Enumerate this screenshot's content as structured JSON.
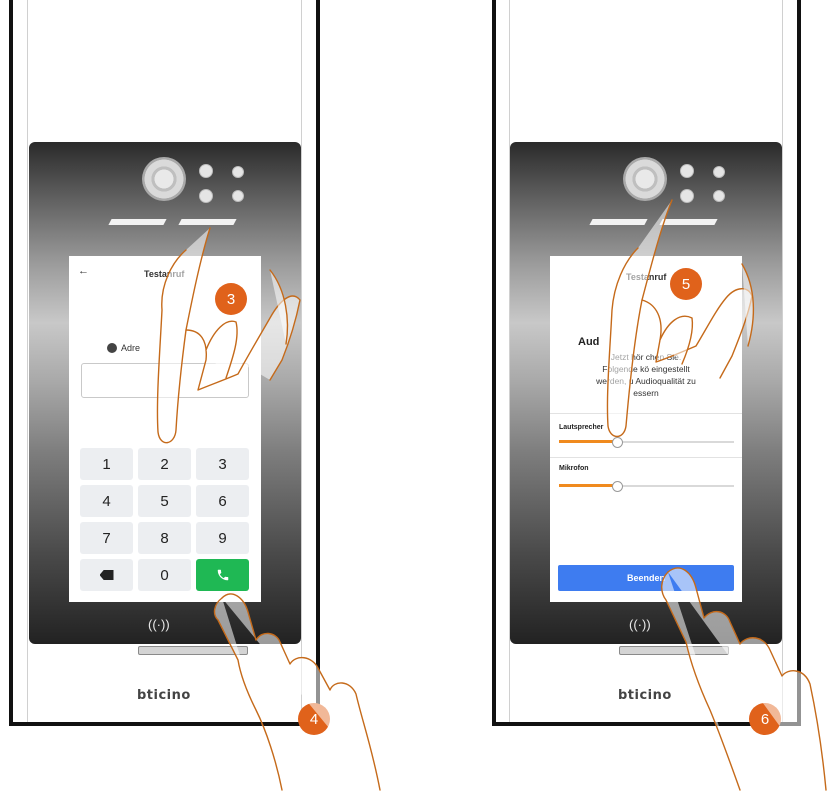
{
  "left": {
    "screen_title": "Testanruf",
    "address_label": "Adre",
    "keys": [
      "1",
      "2",
      "3",
      "4",
      "5",
      "6",
      "7",
      "8",
      "9",
      "",
      "0",
      ""
    ],
    "nfc_symbol": "((·))",
    "brand": "bticino",
    "step_badges": [
      "3",
      "4"
    ]
  },
  "right": {
    "screen_title": "Testanruf",
    "audio_heading": "Aud",
    "audio_text_lines": [
      "Jetzt hör          chen Sie.",
      "Folgende          kö   eingestellt",
      "werden, u       Audioqualität zu",
      "          essern"
    ],
    "speaker_label": "Lautsprecher",
    "speaker_level": 0.33,
    "mic_label": "Mikrofon",
    "mic_level": 0.33,
    "end_button": "Beenden",
    "nfc_symbol": "((·))",
    "brand": "bticino",
    "step_badges": [
      "5",
      "6"
    ]
  },
  "colors": {
    "badge": "#e0621b",
    "call_key": "#1fb854",
    "end_button": "#3e7cf0",
    "slider_fill": "#f08a1e",
    "hand_outline": "#c56a1a"
  }
}
